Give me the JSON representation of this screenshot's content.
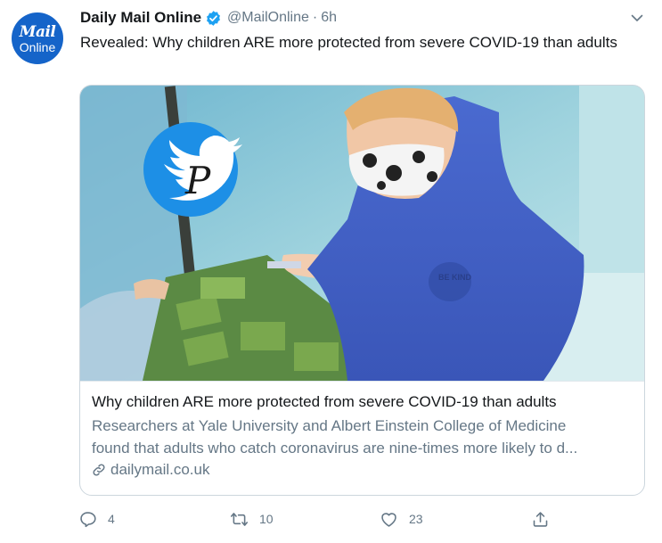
{
  "author": {
    "name": "Daily Mail Online",
    "handle": "@MailOnline",
    "separator": "·",
    "time": "6h",
    "avatar_line1": "Mail",
    "avatar_line2": "Online",
    "verified": true
  },
  "tweet": {
    "text": "Revealed: Why children ARE more protected from severe COVID-19 than adults"
  },
  "card": {
    "image_label": "Photo of a boy wearing a face mask",
    "watermark_letter": "P",
    "title": "Why children ARE more protected from severe COVID-19 than adults",
    "description_line1": "Researchers at Yale University and Albert Einstein College of Medicine",
    "description_line2": "found that adults who catch coronavirus are nine-times more likely to d...",
    "domain": "dailymail.co.uk"
  },
  "actions": {
    "replies": "4",
    "retweets": "10",
    "likes": "23"
  },
  "icons": {
    "reply": "reply-icon",
    "retweet": "retweet-icon",
    "like": "heart-icon",
    "share": "share-icon",
    "link": "link-icon",
    "verified": "verified-badge-icon",
    "caret": "chevron-down-icon"
  },
  "colors": {
    "accent": "#1da1f2",
    "secondary_text": "#657786",
    "primary_text": "#14171a",
    "border": "#ccd6dd",
    "avatar_bg": "#1564c9"
  }
}
